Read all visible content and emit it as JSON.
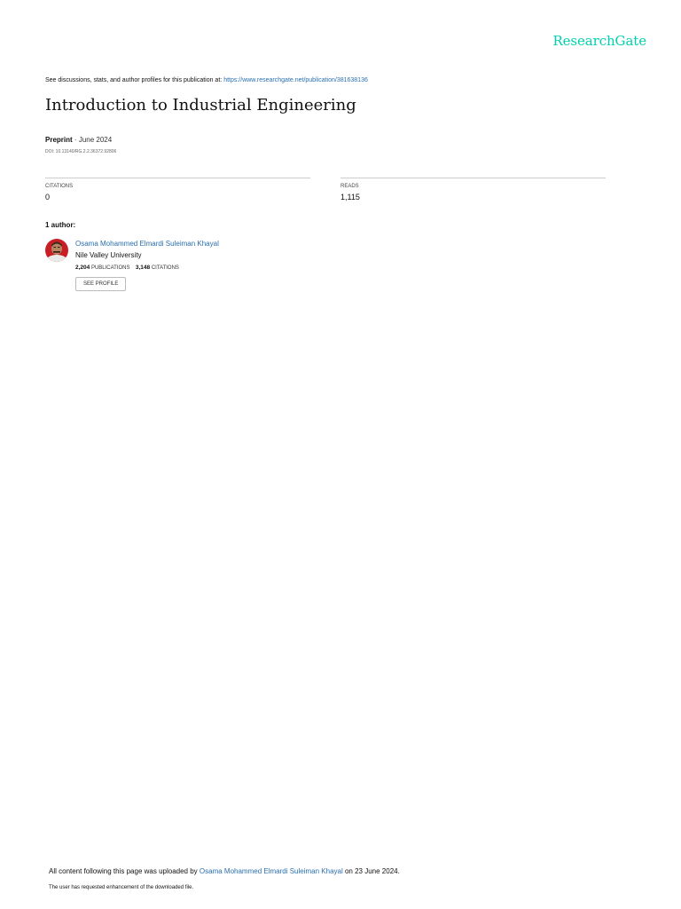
{
  "brand": {
    "name": "ResearchGate",
    "color": "#00d0af"
  },
  "header": {
    "disclaimer_prefix": "See discussions, stats, and author profiles for this publication at:",
    "publication_url": "https://www.researchgate.net/publication/381638136"
  },
  "publication": {
    "title": "Introduction to Industrial Engineering",
    "type": "Preprint",
    "date_separator": "·",
    "date": "June 2024",
    "doi": "DOI: 10.13140/RG.2.2.36372.92806"
  },
  "stats": {
    "citations_label": "CITATIONS",
    "citations_value": "0",
    "reads_label": "READS",
    "reads_value": "1,115"
  },
  "authors": {
    "heading": "1 author:",
    "list": [
      {
        "name": "Osama Mohammed Elmardi Suleiman Khayal",
        "institution": "Nile Valley University",
        "publications_count": "2,204",
        "publications_label": "PUBLICATIONS",
        "citations_count": "3,148",
        "citations_label": "CITATIONS",
        "profile_button": "SEE PROFILE"
      }
    ]
  },
  "footer": {
    "upload_prefix": "All content following this page was uploaded by",
    "uploader": "Osama Mohammed Elmardi Suleiman Khayal",
    "upload_suffix": "on 23 June 2024.",
    "note": "The user has requested enhancement of the downloaded file."
  },
  "colors": {
    "link": "#2a6fb0",
    "text": "#111111",
    "divider": "#cccccc"
  }
}
